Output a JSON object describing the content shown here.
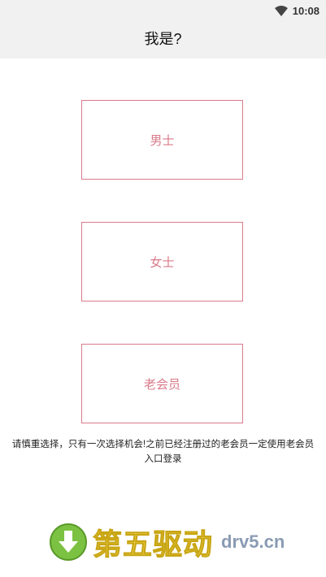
{
  "status": {
    "time": "10:08"
  },
  "header": {
    "title": "我是?"
  },
  "options": {
    "male": "男士",
    "female": "女士",
    "old_member": "老会员"
  },
  "notice": "请慎重选择，只有一次选择机会!之前已经注册过的老会员一定使用老会员 入口登录",
  "watermark": {
    "text": "第五驱动",
    "domain": "drv5.cn"
  },
  "colors": {
    "accent": "#d97a8a",
    "topbar": "#f1f1f1"
  }
}
